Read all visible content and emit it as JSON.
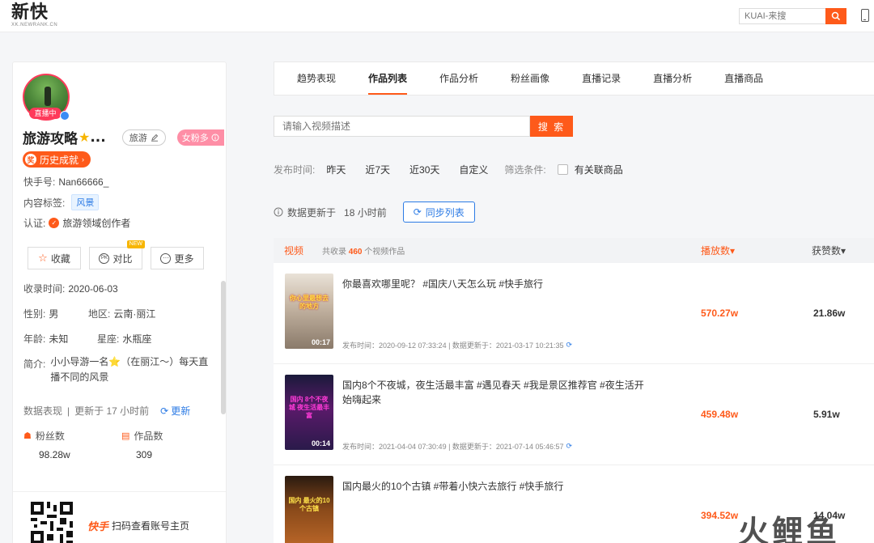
{
  "header": {
    "logo_main": "新快",
    "logo_sub": "XK.NEWRANK.CN",
    "search_placeholder": "KUAI-来搜"
  },
  "profile": {
    "live_label": "直播中",
    "name": "旅游攻略",
    "name_suffix": "...",
    "travel_tag": "旅游",
    "fan_tag": "女粉多",
    "history_label": "历史成就",
    "account_label": "快手号:",
    "account_id": "Nan66666_",
    "content_tag_label": "内容标签:",
    "content_tag": "风景",
    "verify_label": "认证:",
    "verify_text": "旅游领域创作者",
    "buttons": {
      "favorite": "收藏",
      "compare": "对比",
      "more": "更多",
      "new_badge": "NEW"
    },
    "indexed_time_label": "收录时间:",
    "indexed_time": "2020-06-03",
    "gender_label": "性别:",
    "gender": "男",
    "region_label": "地区:",
    "region": "云南·丽江",
    "age_label": "年龄:",
    "age": "未知",
    "zodiac_label": "星座:",
    "zodiac": "水瓶座",
    "bio_label": "简介:",
    "bio": "小小导游一名⭐（在丽江～）每天直播不同的风景",
    "data_perf_label": "数据表现",
    "data_update": "更新于 17 小时前",
    "refresh_label": "更新",
    "fans_label": "粉丝数",
    "fans_value": "98.28w",
    "works_label": "作品数",
    "works_value": "309",
    "qr_brand": "快手",
    "qr_text": "扫码查看账号主页"
  },
  "tabs": [
    "趋势表现",
    "作品列表",
    "作品分析",
    "粉丝画像",
    "直播记录",
    "直播分析",
    "直播商品"
  ],
  "search": {
    "placeholder": "请输入视频描述",
    "button": "搜 索"
  },
  "filters": {
    "time_label": "发布时间:",
    "options": [
      "昨天",
      "近7天",
      "近30天",
      "自定义"
    ],
    "condition_label": "筛选条件:",
    "checkbox_label": "有关联商品"
  },
  "update": {
    "text": "数据更新于",
    "hours": "18 小时前",
    "sync_button": "同步列表"
  },
  "table": {
    "col_video": "视频",
    "count_prefix": "共收录",
    "count": "460",
    "count_suffix": "个视频作品",
    "col_plays": "播放数▾",
    "col_likes": "获赞数▾",
    "rows": [
      {
        "title": "你最喜欢哪里呢？ #国庆八天怎么玩 #快手旅行",
        "duration": "00:17",
        "caption": "你心里最想去的地方",
        "meta": "发布时间：2020-09-12 07:33:24 | 数据更新于：2021-03-17 10:21:35",
        "plays": "570.27w",
        "likes": "21.86w"
      },
      {
        "title": "国内8个不夜城，夜生活最丰富 #遇见春天 #我是景区推荐官 #夜生活开始嗨起来",
        "duration": "00:14",
        "caption": "国内 8个不夜城 夜生活最丰富",
        "meta": "发布时间：2021-04-04 07:30:49 | 数据更新于：2021-07-14 05:46:57",
        "plays": "459.48w",
        "likes": "5.91w"
      },
      {
        "title": "国内最火的10个古镇 #带着小快六去旅行 #快手旅行",
        "duration": "",
        "caption": "国内 最火的10个古镇",
        "meta": "",
        "plays": "394.52w",
        "likes": "14.04w"
      }
    ]
  },
  "watermark": "火鲤鱼",
  "colors": {
    "accent": "#fe5a1a",
    "blue": "#2c7be5",
    "live": "#fe3a5a"
  }
}
